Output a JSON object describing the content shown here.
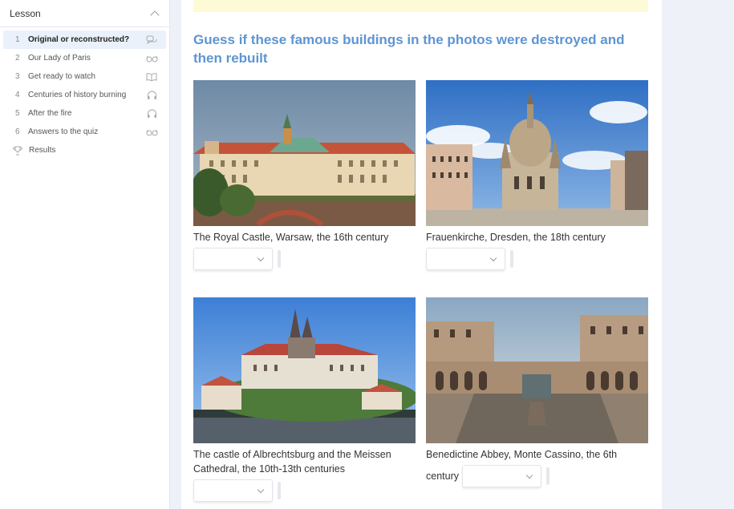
{
  "sidebar": {
    "title": "Lesson",
    "items": [
      {
        "num": "1",
        "label": "Original or reconstructed?",
        "icon": "chat-bubbles-icon",
        "active": true
      },
      {
        "num": "2",
        "label": "Our Lady of Paris",
        "icon": "glasses-icon"
      },
      {
        "num": "3",
        "label": "Get ready to watch",
        "icon": "book-icon"
      },
      {
        "num": "4",
        "label": "Centuries of history burning",
        "icon": "headphones-icon"
      },
      {
        "num": "5",
        "label": "After the fire",
        "icon": "headphones-icon"
      },
      {
        "num": "6",
        "label": "Answers to the quiz",
        "icon": "glasses-icon"
      }
    ],
    "results_label": "Results"
  },
  "main": {
    "question": "Guess if these famous buildings in the photos were destroyed and then rebuilt",
    "cards": [
      {
        "caption": "The Royal Castle, Warsaw, the 16th century",
        "selected": ""
      },
      {
        "caption": "Frauenkirche, Dresden, the 18th century",
        "selected": ""
      },
      {
        "caption": "The castle of Albrechtsburg and the Meissen Cathedral, the 10th-13th centuries",
        "selected": ""
      },
      {
        "caption_part1": "Benedictine Abbey, Monte Cassino, the 6th",
        "caption_part2": "century",
        "selected": ""
      }
    ]
  },
  "colors": {
    "accent": "#5d95d3",
    "banner": "#fdfbd5",
    "active_item_bg": "#eaf1fb"
  }
}
